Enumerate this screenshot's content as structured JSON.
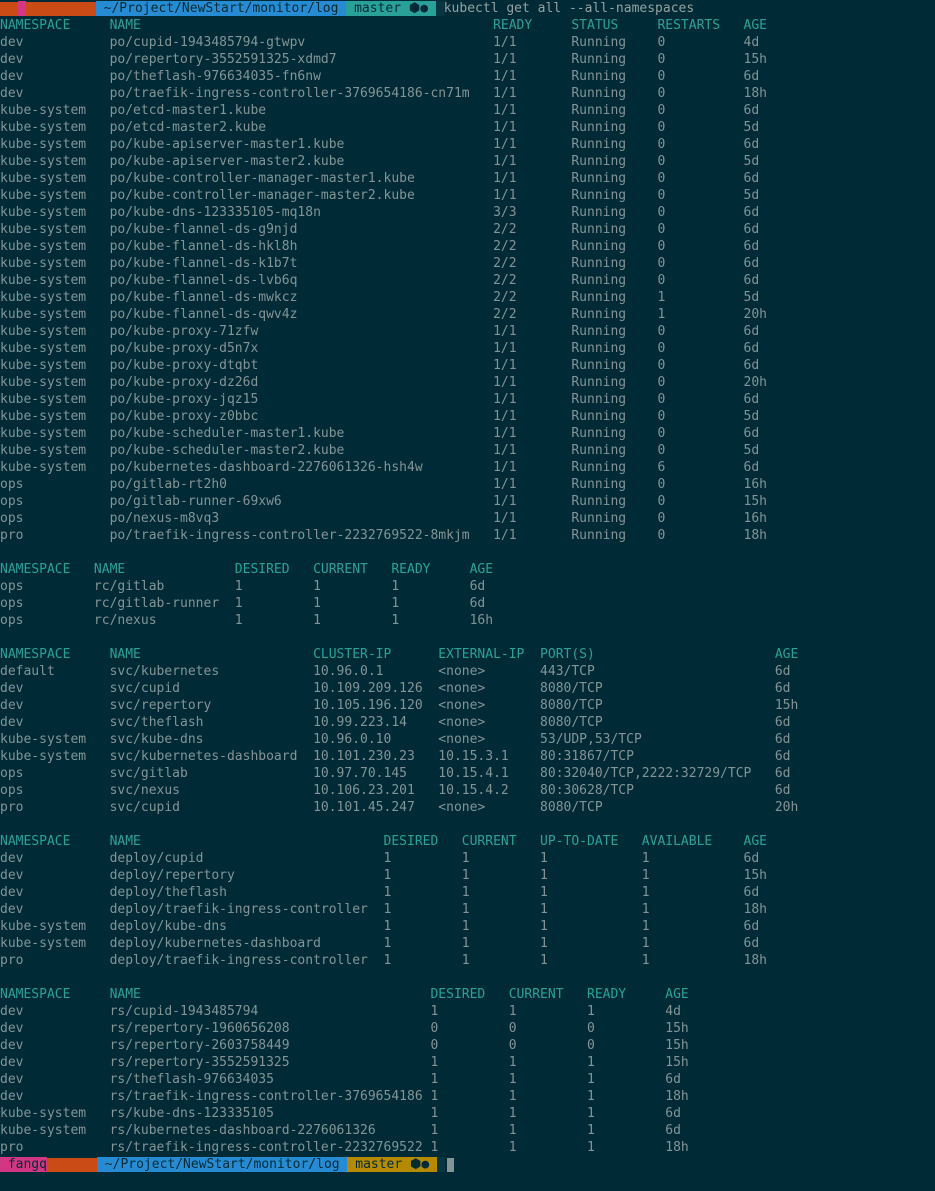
{
  "prompt": {
    "path": " ~/Project/NewStart/monitor/log ",
    "branch": " master ⬢● ",
    "branch2": " master ⬢● ",
    "command": "kubectl get all --all-namespaces"
  },
  "pods": {
    "headers": [
      "NAMESPACE",
      "NAME",
      "READY",
      "STATUS",
      "RESTARTS",
      "AGE"
    ],
    "rows": [
      [
        "dev",
        "po/cupid-1943485794-gtwpv",
        "1/1",
        "Running",
        "0",
        "4d"
      ],
      [
        "dev",
        "po/repertory-3552591325-xdmd7",
        "1/1",
        "Running",
        "0",
        "15h"
      ],
      [
        "dev",
        "po/theflash-976634035-fn6nw",
        "1/1",
        "Running",
        "0",
        "6d"
      ],
      [
        "dev",
        "po/traefik-ingress-controller-3769654186-cn71m",
        "1/1",
        "Running",
        "0",
        "18h"
      ],
      [
        "kube-system",
        "po/etcd-master1.kube",
        "1/1",
        "Running",
        "0",
        "6d"
      ],
      [
        "kube-system",
        "po/etcd-master2.kube",
        "1/1",
        "Running",
        "0",
        "5d"
      ],
      [
        "kube-system",
        "po/kube-apiserver-master1.kube",
        "1/1",
        "Running",
        "0",
        "6d"
      ],
      [
        "kube-system",
        "po/kube-apiserver-master2.kube",
        "1/1",
        "Running",
        "0",
        "5d"
      ],
      [
        "kube-system",
        "po/kube-controller-manager-master1.kube",
        "1/1",
        "Running",
        "0",
        "6d"
      ],
      [
        "kube-system",
        "po/kube-controller-manager-master2.kube",
        "1/1",
        "Running",
        "0",
        "5d"
      ],
      [
        "kube-system",
        "po/kube-dns-123335105-mq18n",
        "3/3",
        "Running",
        "0",
        "6d"
      ],
      [
        "kube-system",
        "po/kube-flannel-ds-g9njd",
        "2/2",
        "Running",
        "0",
        "6d"
      ],
      [
        "kube-system",
        "po/kube-flannel-ds-hkl8h",
        "2/2",
        "Running",
        "0",
        "6d"
      ],
      [
        "kube-system",
        "po/kube-flannel-ds-k1b7t",
        "2/2",
        "Running",
        "0",
        "6d"
      ],
      [
        "kube-system",
        "po/kube-flannel-ds-lvb6q",
        "2/2",
        "Running",
        "0",
        "6d"
      ],
      [
        "kube-system",
        "po/kube-flannel-ds-mwkcz",
        "2/2",
        "Running",
        "1",
        "5d"
      ],
      [
        "kube-system",
        "po/kube-flannel-ds-qwv4z",
        "2/2",
        "Running",
        "1",
        "20h"
      ],
      [
        "kube-system",
        "po/kube-proxy-71zfw",
        "1/1",
        "Running",
        "0",
        "6d"
      ],
      [
        "kube-system",
        "po/kube-proxy-d5n7x",
        "1/1",
        "Running",
        "0",
        "6d"
      ],
      [
        "kube-system",
        "po/kube-proxy-dtqbt",
        "1/1",
        "Running",
        "0",
        "6d"
      ],
      [
        "kube-system",
        "po/kube-proxy-dz26d",
        "1/1",
        "Running",
        "0",
        "20h"
      ],
      [
        "kube-system",
        "po/kube-proxy-jqz15",
        "1/1",
        "Running",
        "0",
        "6d"
      ],
      [
        "kube-system",
        "po/kube-proxy-z0bbc",
        "1/1",
        "Running",
        "0",
        "5d"
      ],
      [
        "kube-system",
        "po/kube-scheduler-master1.kube",
        "1/1",
        "Running",
        "0",
        "6d"
      ],
      [
        "kube-system",
        "po/kube-scheduler-master2.kube",
        "1/1",
        "Running",
        "0",
        "5d"
      ],
      [
        "kube-system",
        "po/kubernetes-dashboard-2276061326-hsh4w",
        "1/1",
        "Running",
        "6",
        "6d"
      ],
      [
        "ops",
        "po/gitlab-rt2h0",
        "1/1",
        "Running",
        "0",
        "16h"
      ],
      [
        "ops",
        "po/gitlab-runner-69xw6",
        "1/1",
        "Running",
        "0",
        "15h"
      ],
      [
        "ops",
        "po/nexus-m8vq3",
        "1/1",
        "Running",
        "0",
        "16h"
      ],
      [
        "pro",
        "po/traefik-ingress-controller-2232769522-8mkjm",
        "1/1",
        "Running",
        "0",
        "18h"
      ]
    ]
  },
  "rc": {
    "headers": [
      "NAMESPACE",
      "NAME",
      "DESIRED",
      "CURRENT",
      "READY",
      "AGE"
    ],
    "rows": [
      [
        "ops",
        "rc/gitlab",
        "1",
        "1",
        "1",
        "6d"
      ],
      [
        "ops",
        "rc/gitlab-runner",
        "1",
        "1",
        "1",
        "6d"
      ],
      [
        "ops",
        "rc/nexus",
        "1",
        "1",
        "1",
        "16h"
      ]
    ]
  },
  "svc": {
    "headers": [
      "NAMESPACE",
      "NAME",
      "CLUSTER-IP",
      "EXTERNAL-IP",
      "PORT(S)",
      "AGE"
    ],
    "rows": [
      [
        "default",
        "svc/kubernetes",
        "10.96.0.1",
        "<none>",
        "443/TCP",
        "6d"
      ],
      [
        "dev",
        "svc/cupid",
        "10.109.209.126",
        "<none>",
        "8080/TCP",
        "6d"
      ],
      [
        "dev",
        "svc/repertory",
        "10.105.196.120",
        "<none>",
        "8080/TCP",
        "15h"
      ],
      [
        "dev",
        "svc/theflash",
        "10.99.223.14",
        "<none>",
        "8080/TCP",
        "6d"
      ],
      [
        "kube-system",
        "svc/kube-dns",
        "10.96.0.10",
        "<none>",
        "53/UDP,53/TCP",
        "6d"
      ],
      [
        "kube-system",
        "svc/kubernetes-dashboard",
        "10.101.230.23",
        "10.15.3.1",
        "80:31867/TCP",
        "6d"
      ],
      [
        "ops",
        "svc/gitlab",
        "10.97.70.145",
        "10.15.4.1",
        "80:32040/TCP,2222:32729/TCP",
        "6d"
      ],
      [
        "ops",
        "svc/nexus",
        "10.106.23.201",
        "10.15.4.2",
        "80:30628/TCP",
        "6d"
      ],
      [
        "pro",
        "svc/cupid",
        "10.101.45.247",
        "<none>",
        "8080/TCP",
        "20h"
      ]
    ]
  },
  "deploy": {
    "headers": [
      "NAMESPACE",
      "NAME",
      "DESIRED",
      "CURRENT",
      "UP-TO-DATE",
      "AVAILABLE",
      "AGE"
    ],
    "rows": [
      [
        "dev",
        "deploy/cupid",
        "1",
        "1",
        "1",
        "1",
        "6d"
      ],
      [
        "dev",
        "deploy/repertory",
        "1",
        "1",
        "1",
        "1",
        "15h"
      ],
      [
        "dev",
        "deploy/theflash",
        "1",
        "1",
        "1",
        "1",
        "6d"
      ],
      [
        "dev",
        "deploy/traefik-ingress-controller",
        "1",
        "1",
        "1",
        "1",
        "18h"
      ],
      [
        "kube-system",
        "deploy/kube-dns",
        "1",
        "1",
        "1",
        "1",
        "6d"
      ],
      [
        "kube-system",
        "deploy/kubernetes-dashboard",
        "1",
        "1",
        "1",
        "1",
        "6d"
      ],
      [
        "pro",
        "deploy/traefik-ingress-controller",
        "1",
        "1",
        "1",
        "1",
        "18h"
      ]
    ]
  },
  "rs": {
    "headers": [
      "NAMESPACE",
      "NAME",
      "DESIRED",
      "CURRENT",
      "READY",
      "AGE"
    ],
    "rows": [
      [
        "dev",
        "rs/cupid-1943485794",
        "1",
        "1",
        "1",
        "4d"
      ],
      [
        "dev",
        "rs/repertory-1960656208",
        "0",
        "0",
        "0",
        "15h"
      ],
      [
        "dev",
        "rs/repertory-2603758449",
        "0",
        "0",
        "0",
        "15h"
      ],
      [
        "dev",
        "rs/repertory-3552591325",
        "1",
        "1",
        "1",
        "15h"
      ],
      [
        "dev",
        "rs/theflash-976634035",
        "1",
        "1",
        "1",
        "6d"
      ],
      [
        "dev",
        "rs/traefik-ingress-controller-3769654186",
        "1",
        "1",
        "1",
        "18h"
      ],
      [
        "kube-system",
        "rs/kube-dns-123335105",
        "1",
        "1",
        "1",
        "6d"
      ],
      [
        "kube-system",
        "rs/kubernetes-dashboard-2276061326",
        "1",
        "1",
        "1",
        "6d"
      ],
      [
        "pro",
        "rs/traefik-ingress-controller-2232769522",
        "1",
        "1",
        "1",
        "18h"
      ]
    ]
  }
}
